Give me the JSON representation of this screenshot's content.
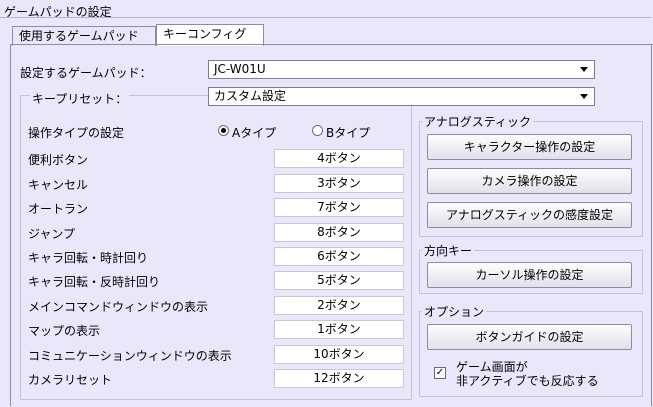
{
  "window_title": "ゲームパッドの設定",
  "tabs": [
    {
      "label": "使用するゲームパッド"
    },
    {
      "label": "キーコンフィグ"
    }
  ],
  "gamepad": {
    "label": "設定するゲームパッド：",
    "value": "JC-W01U"
  },
  "preset": {
    "label": "キープリセット：",
    "value": "カスタム設定"
  },
  "operation_type": {
    "label": "操作タイプの設定",
    "option_a": "Aタイプ",
    "option_b": "Bタイプ",
    "selected": "A"
  },
  "bindings": [
    {
      "action": "便利ボタン",
      "value": "4ボタン"
    },
    {
      "action": "キャンセル",
      "value": "3ボタン"
    },
    {
      "action": "オートラン",
      "value": "7ボタン"
    },
    {
      "action": "ジャンプ",
      "value": "8ボタン"
    },
    {
      "action": "キャラ回転・時計回り",
      "value": "6ボタン"
    },
    {
      "action": "キャラ回転・反時計回り",
      "value": "5ボタン"
    },
    {
      "action": "メインコマンドウィンドウの表示",
      "value": "2ボタン"
    },
    {
      "action": "マップの表示",
      "value": "1ボタン"
    },
    {
      "action": "コミュニケーションウィンドウの表示",
      "value": "10ボタン"
    },
    {
      "action": "カメラリセット",
      "value": "12ボタン"
    }
  ],
  "analog_group": {
    "title": "アナログスティック",
    "buttons": [
      "キャラクター操作の設定",
      "カメラ操作の設定",
      "アナログスティックの感度設定"
    ]
  },
  "direction_group": {
    "title": "方向キー",
    "button": "カーソル操作の設定"
  },
  "option_group": {
    "title": "オプション",
    "button": "ボタンガイドの設定",
    "checkbox_line1": "ゲーム画面が",
    "checkbox_line2": "非アクティブでも反応する",
    "checkbox_checked": true
  }
}
